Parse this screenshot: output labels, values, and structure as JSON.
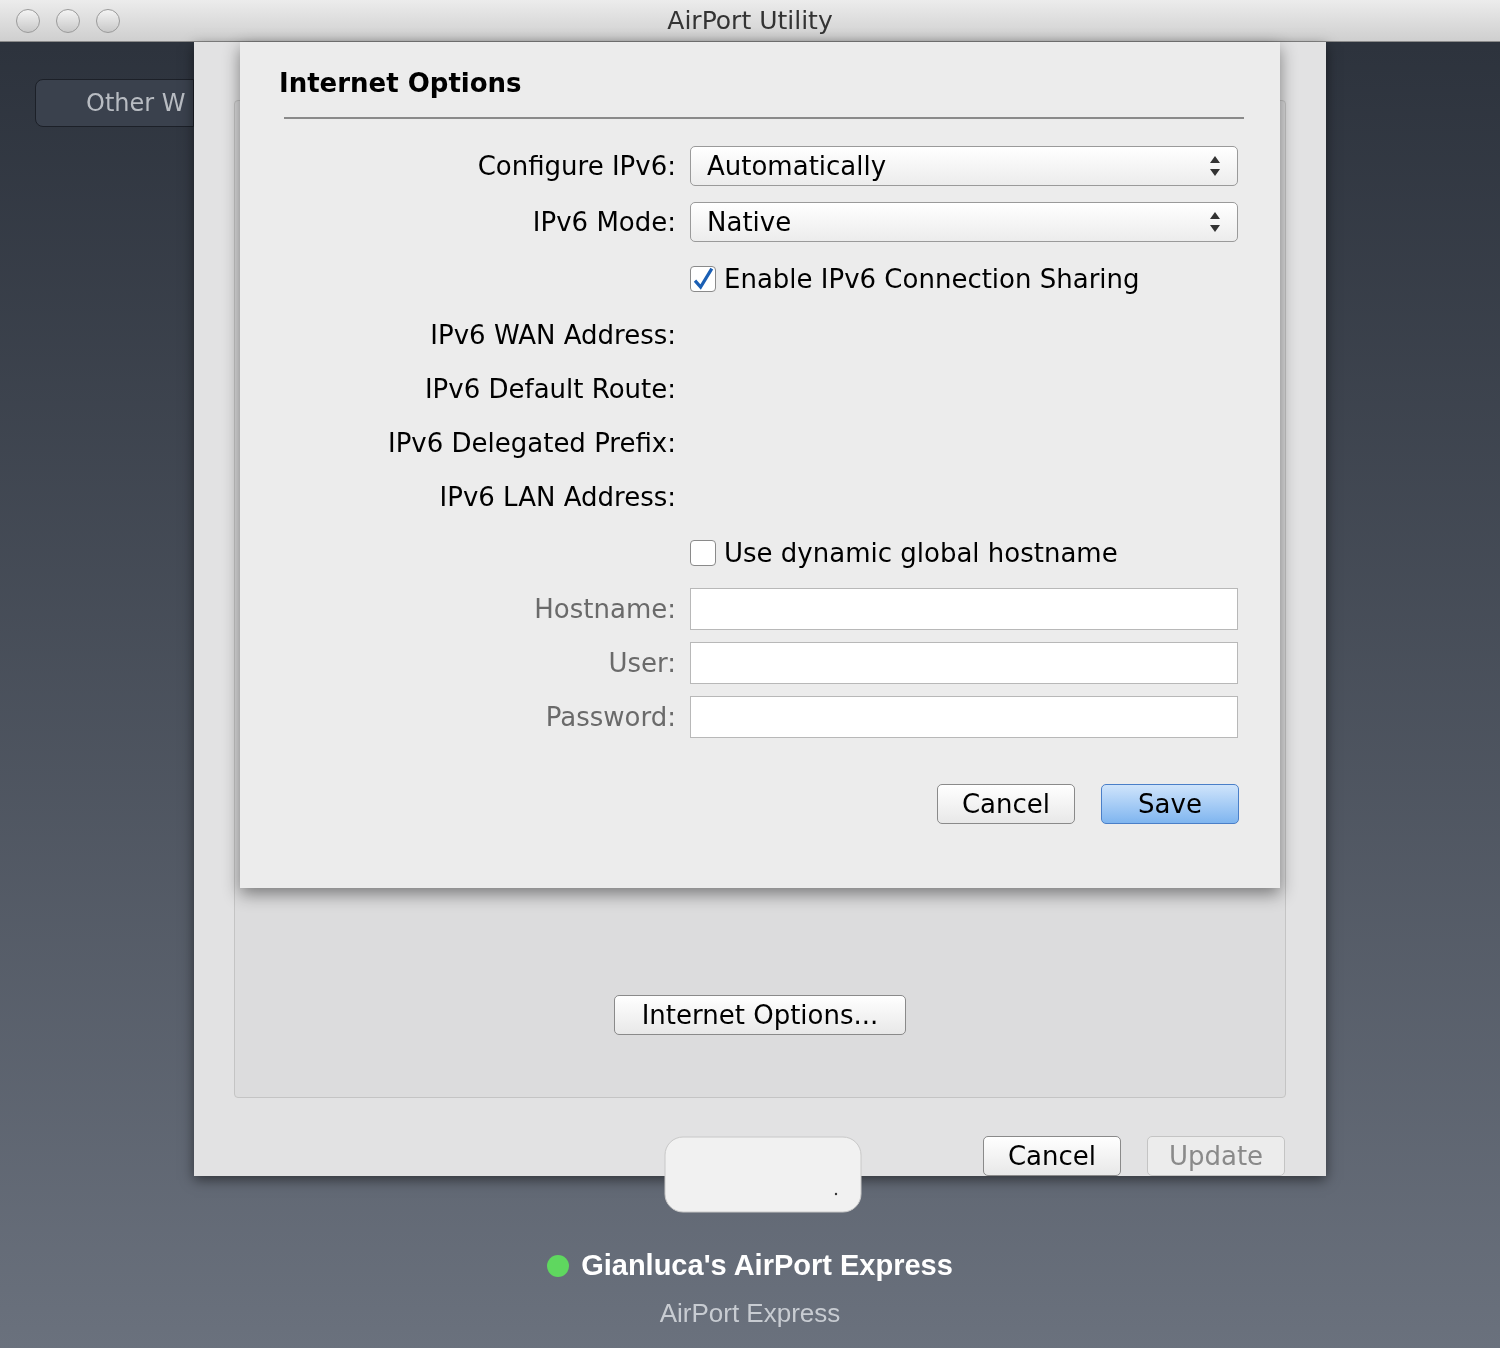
{
  "window": {
    "title": "AirPort Utility"
  },
  "sidebar_button": {
    "label": "Other W"
  },
  "sheet": {
    "title": "Internet Options",
    "fields": [
      {
        "kind": "popup",
        "label": "Configure IPv6:",
        "value": "Automatically"
      },
      {
        "kind": "popup",
        "label": "IPv6 Mode:",
        "value": "Native"
      },
      {
        "kind": "checkbox",
        "label": "Enable IPv6 Connection Sharing",
        "checked": true
      },
      {
        "kind": "info",
        "label": "IPv6 WAN Address:"
      },
      {
        "kind": "info",
        "label": "IPv6 Default Route:"
      },
      {
        "kind": "info",
        "label": "IPv6 Delegated Prefix:"
      },
      {
        "kind": "info",
        "label": "IPv6 LAN Address:"
      },
      {
        "kind": "checkbox",
        "label": "Use dynamic global hostname",
        "checked": false
      },
      {
        "kind": "text",
        "label": "Hostname:",
        "disabled": true
      },
      {
        "kind": "text",
        "label": "User:",
        "disabled": true
      },
      {
        "kind": "text",
        "label": "Password:",
        "disabled": true
      }
    ],
    "buttons": [
      {
        "label": "Cancel",
        "default": false
      },
      {
        "label": "Save",
        "default": true
      }
    ]
  },
  "panel": {
    "internet_options_button": "Internet Options...",
    "buttons": [
      {
        "label": "Cancel",
        "disabled": false
      },
      {
        "label": "Update",
        "disabled": true
      }
    ]
  },
  "device": {
    "name": "Gianluca's AirPort Express",
    "model": "AirPort Express",
    "color": "#5fd75f"
  }
}
